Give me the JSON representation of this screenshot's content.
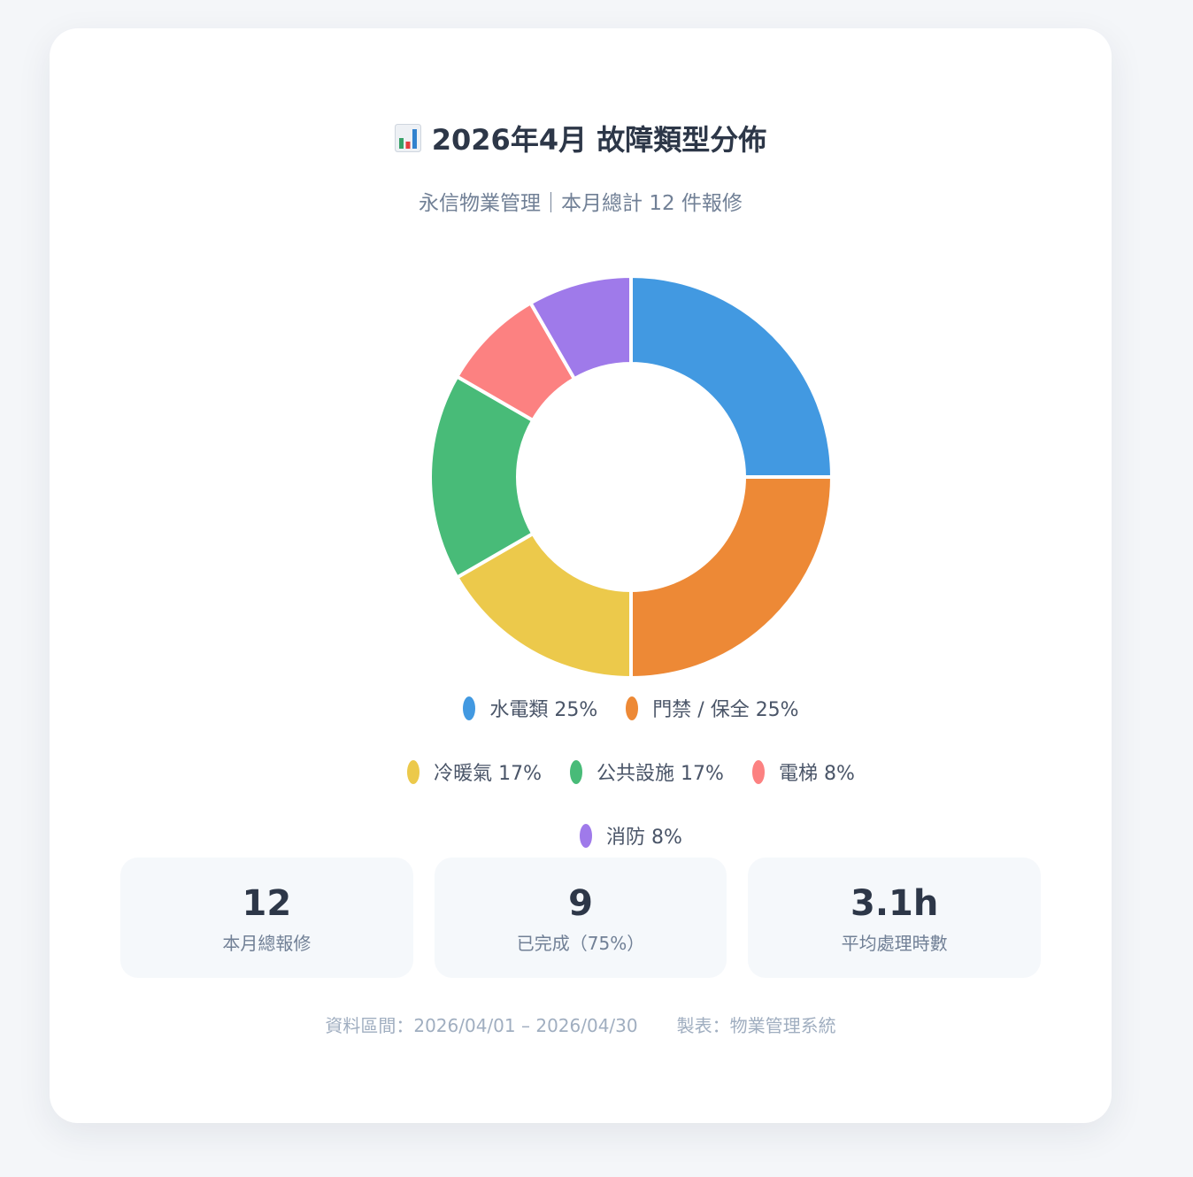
{
  "header": {
    "icon": "bar-chart-icon",
    "title": "2026年4月 故障類型分佈",
    "subtitle": "永信物業管理｜本月總計 12 件報修"
  },
  "chart_data": {
    "type": "pie",
    "style": "donut",
    "title": "2026年4月 故障類型分佈",
    "total": 12,
    "slices": [
      {
        "label": "水電類",
        "count": 3,
        "percent_label": "25%",
        "color": "#4299e1"
      },
      {
        "label": "門禁 / 保全",
        "count": 3,
        "percent_label": "25%",
        "color": "#ed8936"
      },
      {
        "label": "冷暖氣",
        "count": 2,
        "percent_label": "17%",
        "color": "#ecc94b"
      },
      {
        "label": "公共設施",
        "count": 2,
        "percent_label": "17%",
        "color": "#48bb78"
      },
      {
        "label": "電梯",
        "count": 1,
        "percent_label": "8%",
        "color": "#fc8181"
      },
      {
        "label": "消防",
        "count": 1,
        "percent_label": "8%",
        "color": "#9f7aea"
      }
    ],
    "legend_position": "bottom"
  },
  "stats": [
    {
      "value": "12",
      "label": "本月總報修"
    },
    {
      "value": "9",
      "label": "已完成（75%）"
    },
    {
      "value": "3.1h",
      "label": "平均處理時數"
    }
  ],
  "footer": {
    "range": "資料區間：2026/04/01 – 2026/04/30",
    "maker": "製表：物業管理系統"
  }
}
